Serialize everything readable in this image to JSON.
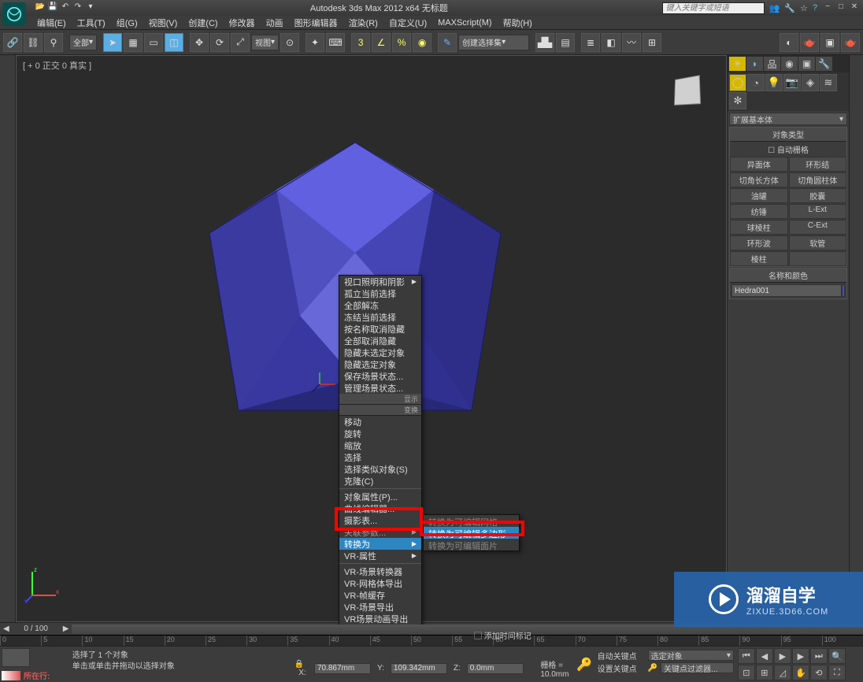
{
  "title": "Autodesk 3ds Max  2012 x64   无标题",
  "search_placeholder": "键入关键字或短语",
  "menus": [
    "编辑(E)",
    "工具(T)",
    "组(G)",
    "视图(V)",
    "创建(C)",
    "修改器",
    "动画",
    "图形编辑器",
    "渲染(R)",
    "自定义(U)",
    "MAXScript(M)",
    "帮助(H)"
  ],
  "toolbar": {
    "all_label": "全部",
    "view_label": "视图",
    "createset_label": "创建选择集"
  },
  "viewport_label": "[ + 0 正交 0 真实 ]",
  "context_menu": {
    "group1": [
      "视口照明和阴影",
      "孤立当前选择",
      "全部解冻",
      "冻结当前选择",
      "按名称取消隐藏",
      "全部取消隐藏",
      "隐藏未选定对象",
      "隐藏选定对象",
      "保存场景状态...",
      "管理场景状态..."
    ],
    "head1": "显示",
    "head2": "变换",
    "group2": [
      "移动",
      "旋转",
      "缩放",
      "选择",
      "选择类似对象(S)",
      "克隆(C)",
      "对象属性(P)...",
      "曲线编辑器...",
      "摄影表...",
      "关联参数...",
      "转换为",
      "VR-属性",
      "VR-场景转换器",
      "VR-网格体导出",
      "VR-帧缓存",
      "VR-场景导出",
      "VR场景动画导出"
    ],
    "submenu": [
      "转换为可编辑网格",
      "转换为可编辑多边形",
      "转换为可编辑面片"
    ]
  },
  "right_panel": {
    "dropdown": "扩展基本体",
    "section_objtype": "对象类型",
    "auto_grid": "自动栅格",
    "objects": [
      "异面体",
      "环形结",
      "切角长方体",
      "切角圆柱体",
      "油罐",
      "胶囊",
      "纺锤",
      "L-Ext",
      "球棱柱",
      "C-Ext",
      "环形波",
      "软管",
      "棱柱",
      ""
    ],
    "section_name": "名称和颜色",
    "object_name": "Hedra001"
  },
  "timeline": {
    "frame": "0 / 100",
    "ticks": [
      "0",
      "5",
      "10",
      "15",
      "20",
      "25",
      "30",
      "35",
      "40",
      "45",
      "50",
      "55",
      "60",
      "65",
      "70",
      "75",
      "80",
      "85",
      "90",
      "95",
      "100"
    ]
  },
  "status": {
    "selection": "选择了 1 个对象",
    "hint": "单击或单击并拖动以选择对象",
    "x": "70.867mm",
    "y": "109.342mm",
    "z": "0.0mm",
    "grid": "栅格 = 10.0mm",
    "add_time": "添加时间标记",
    "now": "所在行:",
    "autokey": "自动关键点",
    "setkey": "设置关键点",
    "selset": "选定对象",
    "keyfilter": "关键点过滤器..."
  },
  "watermark": {
    "big": "溜溜自学",
    "small": "ZIXUE.3D66.COM"
  }
}
